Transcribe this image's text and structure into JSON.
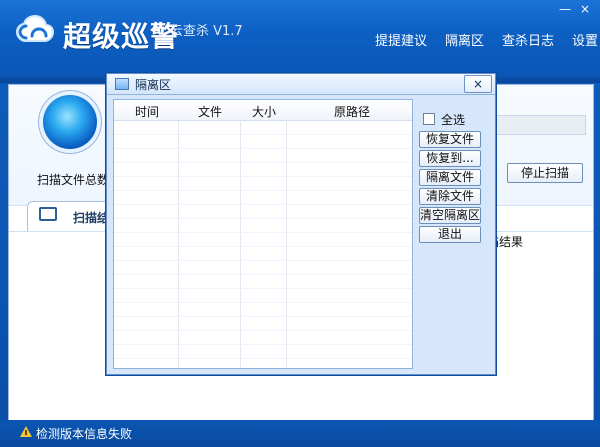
{
  "app": {
    "title": "超级巡警",
    "version": "云查杀 V1.7",
    "nav": [
      "提提建议",
      "隔离区",
      "查杀日志",
      "设置"
    ],
    "window_controls": {
      "minimize": "—",
      "close": "×"
    }
  },
  "main": {
    "scan_total_label": "扫描文件总数:",
    "stop_button": "停止扫描",
    "tab_label": "扫描结",
    "right_header": "描结果"
  },
  "dialog": {
    "title": "隔离区",
    "close_button": "×",
    "columns": [
      "时间",
      "文件",
      "大小",
      "原路径"
    ],
    "select_all": "全选",
    "buttons": [
      "恢复文件",
      "恢复到...",
      "隔离文件",
      "清除文件",
      "清空隔离区",
      "退出"
    ]
  },
  "status": {
    "message": "检测版本信息失败"
  },
  "icons": {
    "logo": "cloud-logo-icon",
    "radar": "radar-icon",
    "dialog": "quarantine-icon",
    "tab": "monitor-icon",
    "warning": "warning-icon"
  }
}
